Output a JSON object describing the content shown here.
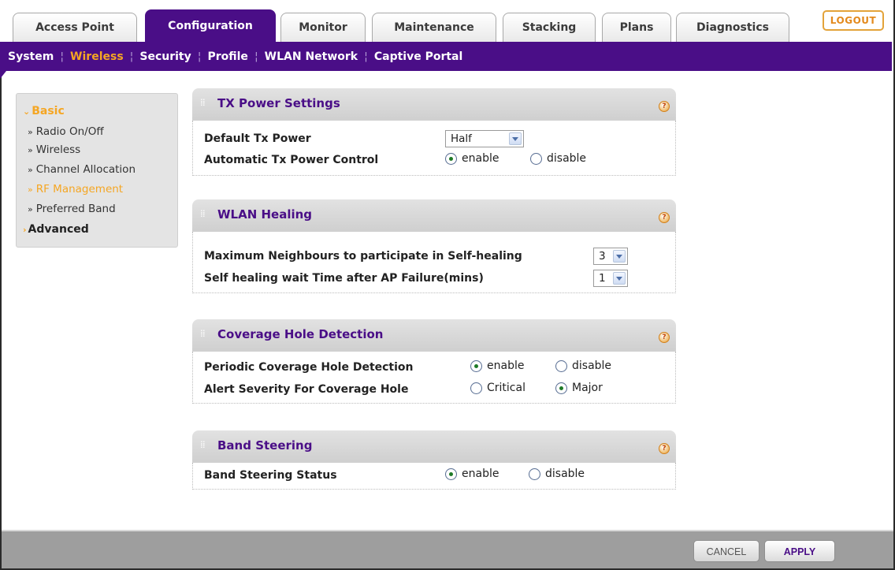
{
  "tabs": [
    {
      "label": "Access Point"
    },
    {
      "label": "Configuration"
    },
    {
      "label": "Monitor"
    },
    {
      "label": "Maintenance"
    },
    {
      "label": "Stacking"
    },
    {
      "label": "Plans"
    },
    {
      "label": "Diagnostics"
    }
  ],
  "active_tab": "Configuration",
  "logout_label": "LOGOUT",
  "subnav": [
    "System",
    "Wireless",
    "Security",
    "Profile",
    "WLAN Network",
    "Captive Portal"
  ],
  "active_subnav": "Wireless",
  "leftmenu": {
    "basic": "Basic",
    "items": [
      "Radio On/Off",
      "Wireless",
      "Channel Allocation",
      "RF Management",
      "Preferred Band"
    ],
    "active_item": "RF Management",
    "advanced": "Advanced"
  },
  "tx_power": {
    "title": "TX Power Settings",
    "default_label": "Default Tx Power",
    "default_value": "Half",
    "auto_label": "Automatic Tx Power Control",
    "enable": "enable",
    "disable": "disable",
    "auto_selected": "enable"
  },
  "wlan_healing": {
    "title": "WLAN Healing",
    "max_label": "Maximum Neighbours to participate in Self-healing",
    "max_value": "3",
    "wait_label": "Self healing wait Time after AP Failure(mins)",
    "wait_value": "1"
  },
  "coverage": {
    "title": "Coverage Hole Detection",
    "periodic_label": "Periodic Coverage Hole Detection",
    "enable": "enable",
    "disable": "disable",
    "periodic_selected": "enable",
    "severity_label": "Alert Severity For Coverage Hole",
    "critical": "Critical",
    "major": "Major",
    "severity_selected": "Major"
  },
  "band_steering": {
    "title": "Band Steering",
    "status_label": "Band Steering Status",
    "enable": "enable",
    "disable": "disable",
    "status_selected": "enable"
  },
  "footer": {
    "cancel": "CANCEL",
    "apply": "APPLY"
  },
  "colors": {
    "brand_purple": "#4a0e87",
    "accent_orange": "#f5a623"
  }
}
